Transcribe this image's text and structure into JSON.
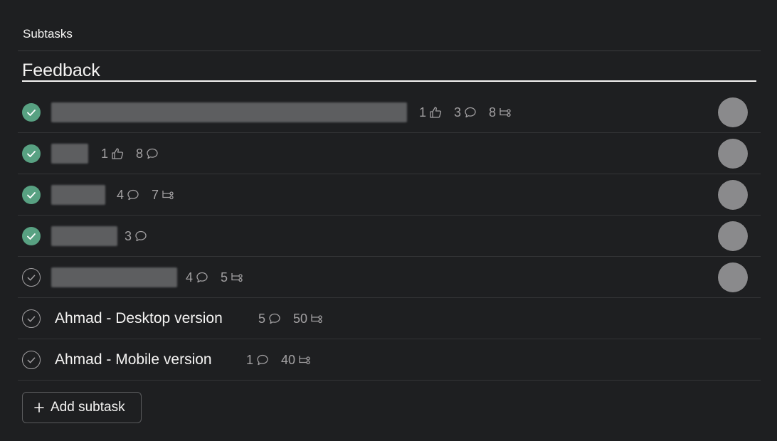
{
  "subtasks_label": "Subtasks",
  "section": {
    "title": "Feedback"
  },
  "tasks": [
    {
      "name": "",
      "completed": true,
      "redacted": true,
      "likes": "1",
      "comments": "3",
      "subtasks": "8",
      "has_avatar": true
    },
    {
      "name": "",
      "completed": true,
      "redacted": true,
      "likes": "1",
      "comments": "8",
      "subtasks": null,
      "has_avatar": true
    },
    {
      "name": "",
      "completed": true,
      "redacted": true,
      "likes": null,
      "comments": "4",
      "subtasks": "7",
      "has_avatar": true
    },
    {
      "name": "",
      "completed": true,
      "redacted": true,
      "likes": null,
      "comments": "3",
      "subtasks": null,
      "has_avatar": true
    },
    {
      "name": "",
      "completed": false,
      "redacted": true,
      "likes": null,
      "comments": "4",
      "subtasks": "5",
      "has_avatar": true
    },
    {
      "name": "Ahmad - Desktop version",
      "completed": false,
      "redacted": false,
      "likes": null,
      "comments": "5",
      "subtasks": "50",
      "has_avatar": false
    },
    {
      "name": "Ahmad - Mobile version",
      "completed": false,
      "redacted": false,
      "likes": null,
      "comments": "1",
      "subtasks": "40",
      "has_avatar": false
    }
  ],
  "add_button": {
    "label": "Add subtask",
    "icon": "plus-icon"
  },
  "icons": {
    "like": "thumbs-up-icon",
    "comment": "comment-bubble-icon",
    "subtask": "subtask-tree-icon",
    "check": "check-circle-icon"
  },
  "colors": {
    "background": "#1e1f21",
    "complete_green": "#58a182",
    "muted_text": "#a2a0a2",
    "text": "#f5f4f3"
  }
}
